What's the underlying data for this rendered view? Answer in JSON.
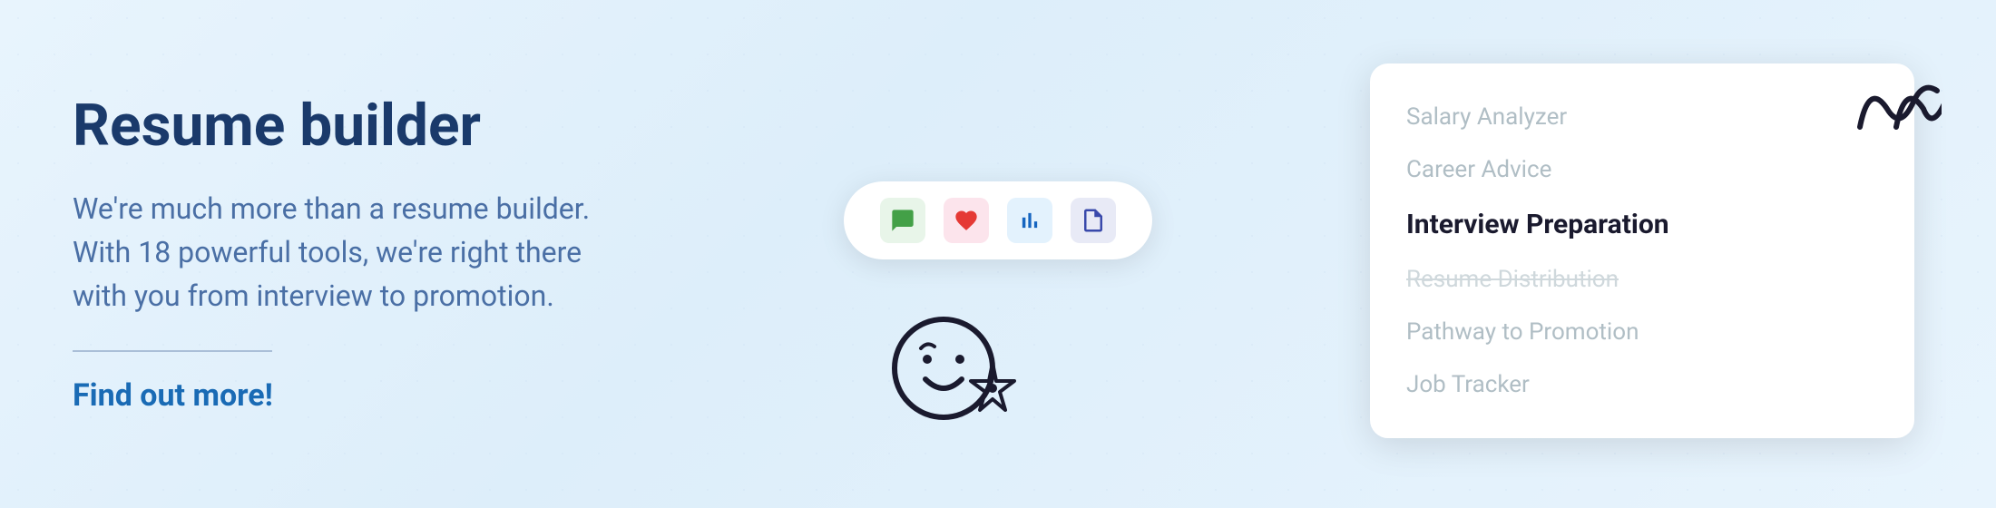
{
  "page": {
    "background_color": "#ddeefa"
  },
  "left": {
    "title": "Resume builder",
    "description": "We're much more than a resume builder. With 18 powerful tools, we're right there with you from interview to promotion.",
    "cta": "Find out more!"
  },
  "right": {
    "toolbar": {
      "icons": [
        {
          "id": "chat-icon",
          "symbol": "💬",
          "color_class": "green",
          "label": "Chat"
        },
        {
          "id": "heart-icon",
          "symbol": "❤️",
          "color_class": "red",
          "label": "Heart"
        },
        {
          "id": "chart-icon",
          "symbol": "📊",
          "color_class": "blue-dark",
          "label": "Chart"
        },
        {
          "id": "document-icon",
          "symbol": "📄",
          "color_class": "blue-light",
          "label": "Document"
        }
      ]
    },
    "dropdown": {
      "items": [
        {
          "id": "salary-analyzer",
          "label": "Salary Analyzer",
          "state": "normal"
        },
        {
          "id": "career-advice",
          "label": "Career Advice",
          "state": "normal"
        },
        {
          "id": "interview-preparation",
          "label": "Interview Preparation",
          "state": "active"
        },
        {
          "id": "resume-distribution",
          "label": "Resume Distribution",
          "state": "dimmed"
        },
        {
          "id": "pathway-to-promotion",
          "label": "Pathway to Promotion",
          "state": "normal"
        },
        {
          "id": "job-tracker",
          "label": "Job Tracker",
          "state": "normal"
        }
      ]
    },
    "smiley": {
      "label": "Smiley face illustration"
    },
    "squiggle": {
      "symbol": "ꝏ",
      "label": "Decorative squiggle"
    }
  }
}
